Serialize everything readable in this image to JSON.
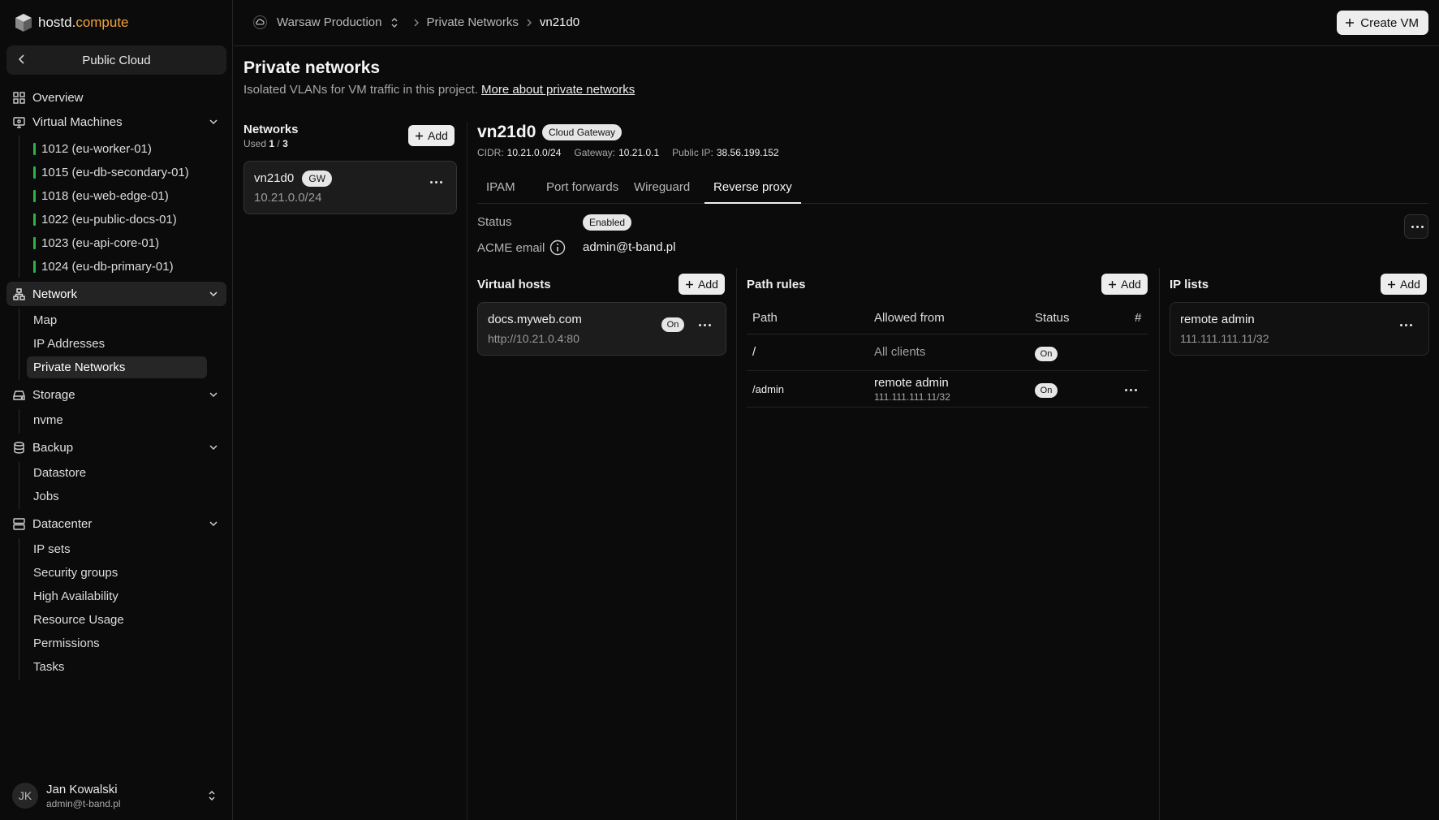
{
  "app": {
    "logo_main": "hostd.",
    "logo_accent": "compute"
  },
  "project_switcher": {
    "label": "Public Cloud"
  },
  "sidebar": {
    "overview": "Overview",
    "virtual_machines": {
      "label": "Virtual Machines",
      "items": [
        "1012 (eu-worker-01)",
        "1015 (eu-db-secondary-01)",
        "1018 (eu-web-edge-01)",
        "1022 (eu-public-docs-01)",
        "1023 (eu-api-core-01)",
        "1024 (eu-db-primary-01)"
      ]
    },
    "network": {
      "label": "Network",
      "items": [
        "Map",
        "IP Addresses",
        "Private Networks"
      ]
    },
    "storage": {
      "label": "Storage",
      "items": [
        "nvme"
      ]
    },
    "backup": {
      "label": "Backup",
      "items": [
        "Datastore",
        "Jobs"
      ]
    },
    "datacenter": {
      "label": "Datacenter",
      "items": [
        "IP sets",
        "Security groups",
        "High Availability",
        "Resource Usage",
        "Permissions",
        "Tasks"
      ]
    }
  },
  "user": {
    "initials": "JK",
    "name": "Jan Kowalski",
    "email": "admin@t-band.pl"
  },
  "breadcrumb": {
    "project": "Warsaw Production",
    "section": "Private Networks",
    "current": "vn21d0"
  },
  "toolbar": {
    "create_vm": "Create VM"
  },
  "page": {
    "title": "Private networks",
    "subtitle": "Isolated VLANs for VM traffic in this project.",
    "link": "More about private networks"
  },
  "networks": {
    "title": "Networks",
    "used_prefix": "Used",
    "used_count": "1",
    "used_sep": "/",
    "used_total": "3",
    "add_label": "Add",
    "items": [
      {
        "name": "vn21d0",
        "badge": "GW",
        "cidr": "10.21.0.0/24"
      }
    ]
  },
  "detail": {
    "name": "vn21d0",
    "badge": "Cloud Gateway",
    "cidr_label": "CIDR:",
    "cidr": "10.21.0.0/24",
    "gateway_label": "Gateway:",
    "gateway": "10.21.0.1",
    "public_ip_label": "Public IP:",
    "public_ip": "38.56.199.152",
    "tabs": [
      "IPAM",
      "Port forwards",
      "Wireguard",
      "Reverse proxy"
    ],
    "active_tab": "Reverse proxy",
    "status_label": "Status",
    "status_value": "Enabled",
    "acme_label": "ACME email",
    "acme_value": "admin@t-band.pl"
  },
  "virtual_hosts": {
    "title": "Virtual hosts",
    "add_label": "Add",
    "items": [
      {
        "host": "docs.myweb.com",
        "target": "http://10.21.0.4:80",
        "status": "On"
      }
    ]
  },
  "path_rules": {
    "title": "Path rules",
    "add_label": "Add",
    "columns": [
      "Path",
      "Allowed from",
      "Status",
      "#"
    ],
    "rows": [
      {
        "path": "/",
        "allowed": "All clients",
        "allowed_sub": "",
        "status": "On"
      },
      {
        "path": "/admin",
        "allowed": "remote admin",
        "allowed_sub": "111.111.111.11/32",
        "status": "On"
      }
    ]
  },
  "ip_lists": {
    "title": "IP lists",
    "add_label": "Add",
    "items": [
      {
        "name": "remote admin",
        "cidr": "111.111.111.11/32"
      }
    ]
  },
  "icons": {
    "logo": "cube-icon",
    "back": "chevron-left-icon",
    "overview": "grid-icon",
    "vms": "monitor-icon",
    "network": "network-icon",
    "storage": "hard-drive-icon",
    "backup": "database-icon",
    "datacenter": "server-icon",
    "project": "cloud-icon",
    "info": "info-icon",
    "more": "more-horizontal-icon",
    "add": "plus-icon"
  },
  "colors": {
    "logo_accent": "#f2a33a",
    "vm_status": "#2bb34a",
    "background": "#0b0b0b"
  }
}
